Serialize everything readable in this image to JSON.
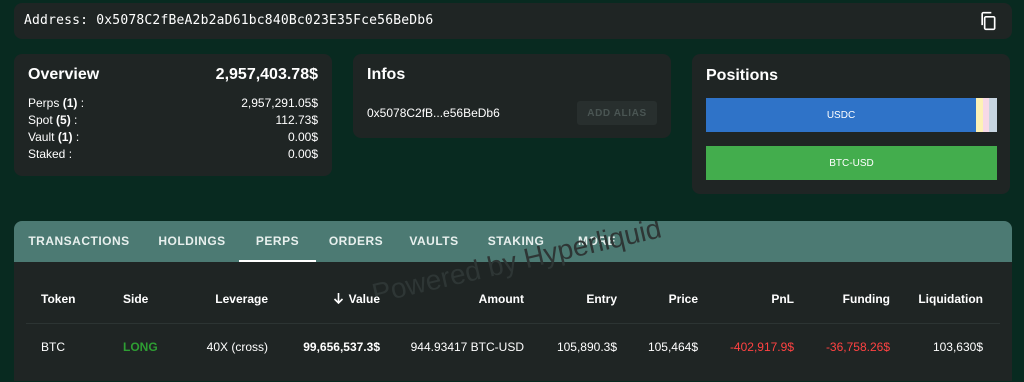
{
  "address_bar": {
    "label": "Address: 0x5078C2fBeA2b2aD61bc840Bc023E35Fce56BeDb6",
    "copy_icon": "copy-icon"
  },
  "overview": {
    "title": "Overview",
    "total": "2,957,403.78$",
    "rows": [
      {
        "label": "Perps",
        "count": "(1)",
        "suffix": " :",
        "value": "2,957,291.05$"
      },
      {
        "label": "Spot",
        "count": "(5)",
        "suffix": " :",
        "value": "112.73$"
      },
      {
        "label": "Vault",
        "count": "(1)",
        "suffix": " :",
        "value": "0.00$"
      },
      {
        "label": "Staked",
        "count": "",
        "suffix": " :",
        "value": "0.00$"
      }
    ]
  },
  "infos": {
    "title": "Infos",
    "short_address": "0x5078C2fB...e56BeDb6",
    "add_alias_label": "ADD ALIAS"
  },
  "positions": {
    "title": "Positions",
    "bars": [
      {
        "label": "USDC",
        "color": "#2f73c8",
        "share": 0.93
      },
      {
        "label": "BTC-USD",
        "color": "#43ad4d",
        "share": 1.0
      }
    ],
    "minor_segment_colors": [
      "#fdf2b6",
      "#f6d9e7",
      "#c7d6e1"
    ]
  },
  "tabs": [
    {
      "label": "TRANSACTIONS",
      "active": false
    },
    {
      "label": "HOLDINGS",
      "active": false
    },
    {
      "label": "PERPS",
      "active": true
    },
    {
      "label": "ORDERS",
      "active": false
    },
    {
      "label": "VAULTS",
      "active": false
    },
    {
      "label": "STAKING",
      "active": false
    },
    {
      "label": "MORE",
      "active": false
    }
  ],
  "table": {
    "headers": {
      "token": "Token",
      "side": "Side",
      "leverage": "Leverage",
      "value": "Value",
      "amount": "Amount",
      "entry": "Entry",
      "price": "Price",
      "pnl": "PnL",
      "funding": "Funding",
      "liquidation": "Liquidation"
    },
    "sort_icon": "arrow-down-icon",
    "rows": [
      {
        "token": "BTC",
        "side": "LONG",
        "leverage": "40X (cross)",
        "value": "99,656,537.3$",
        "amount": "944.93417 BTC-USD",
        "entry": "105,890.3$",
        "price": "105,464$",
        "pnl": "-402,917.9$",
        "funding": "-36,758.26$",
        "liquidation": "103,630$"
      }
    ]
  },
  "watermark": "Powered by Hyperliquid",
  "colors": {
    "background": "#082a20",
    "card": "#1f2524",
    "tab_bar": "#4c7a73",
    "long": "#2e9e33",
    "negative": "#ff4242"
  }
}
